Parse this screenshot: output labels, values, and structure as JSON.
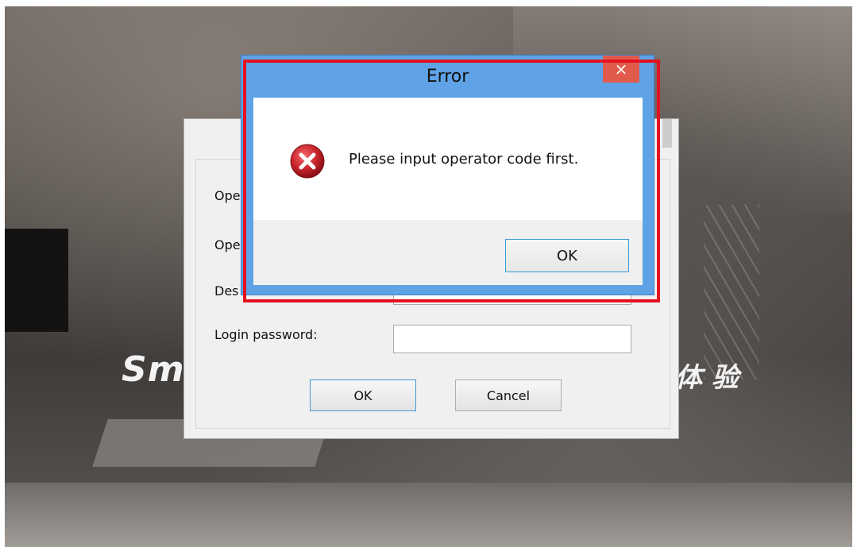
{
  "background": {
    "slogan_left": "Sm",
    "slogan_right": "体 验"
  },
  "login_dialog": {
    "labels": [
      "Ope",
      "Ope",
      "Des",
      "Login password:"
    ],
    "ok_label": "OK",
    "cancel_label": "Cancel"
  },
  "error_dialog": {
    "title": "Error",
    "close_glyph": "×",
    "message": "Please input operator code first.",
    "ok_label": "OK",
    "icon": "error-icon"
  },
  "colors": {
    "title_bar": "#5fa3e6",
    "close_button": "#e15b4c",
    "highlight": "#e4121f",
    "error_icon": "#c8232a"
  }
}
